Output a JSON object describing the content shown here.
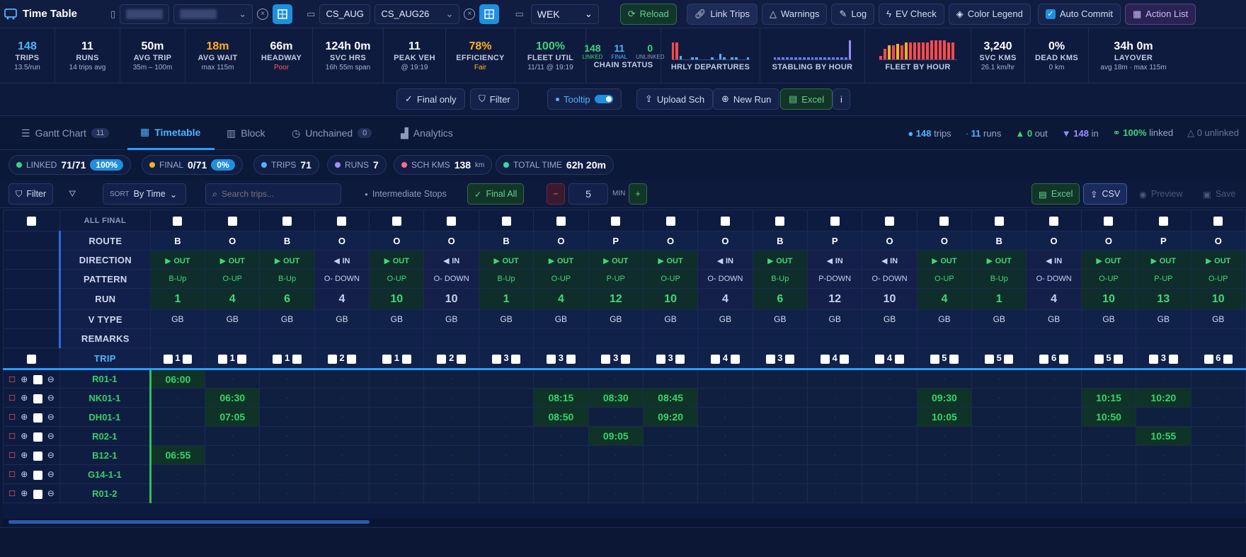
{
  "app": {
    "title": "Time Table"
  },
  "toolbar": {
    "schedule1": "CS_AUG",
    "schedule2": "CS_AUG26",
    "day": "WEK",
    "reload": "Reload",
    "link_trips": "Link Trips",
    "warnings": "Warnings",
    "log": "Log",
    "ev_check": "EV Check",
    "color_legend": "Color Legend",
    "auto_commit": "Auto Commit",
    "action_list": "Action List"
  },
  "stats": [
    {
      "v": "148",
      "l": "TRIPS",
      "s": "13.5/run",
      "color": "#4fb3ff"
    },
    {
      "v": "11",
      "l": "RUNS",
      "s": "14 trips avg",
      "color": "#ffffff"
    },
    {
      "v": "50m",
      "l": "AVG TRIP",
      "s": "35m – 100m",
      "color": "#ffffff"
    },
    {
      "v": "18m",
      "l": "AVG WAIT",
      "s": "max 115m",
      "color": "#ffb020"
    },
    {
      "v": "66m",
      "l": "HEADWAY",
      "s": "Poor",
      "color": "#ffffff",
      "scolor": "#ff5a5a"
    },
    {
      "v": "124h 0m",
      "l": "SVC HRS",
      "s": "16h 55m span",
      "color": "#ffffff"
    },
    {
      "v": "11",
      "l": "PEAK VEH",
      "s": "@ 19:19",
      "color": "#ffffff"
    },
    {
      "v": "78%",
      "l": "EFFICIENCY",
      "s": "Fair",
      "color": "#ffb020",
      "scolor": "#ffb020"
    },
    {
      "v": "100%",
      "l": "FLEET UTIL",
      "s": "11/11 @ 19:19",
      "color": "#3ed47a"
    }
  ],
  "chain": {
    "linked": "148",
    "linked_l": "LINKED",
    "final": "11",
    "final_l": "FINAL",
    "unlinked": "0",
    "unlinked_l": "UNLINKED",
    "label": "CHAIN STATUS"
  },
  "charts": {
    "hourly": "HRLY DEPARTURES",
    "stabling": "STABLING BY HOUR",
    "fleet": "FLEET BY HOUR"
  },
  "stats2": [
    {
      "v": "3,240",
      "l": "SVC KMS",
      "s": "26.1 km/hr"
    },
    {
      "v": "0%",
      "l": "DEAD KMS",
      "s": "0 km"
    },
    {
      "v": "34h 0m",
      "l": "LAYOVER",
      "s": "avg 18m · max 115m"
    }
  ],
  "actions": {
    "final_only": "Final only",
    "filter": "Filter",
    "tooltip": "Tooltip",
    "upload": "Upload Sch",
    "new_run": "New Run",
    "excel": "Excel",
    "info": "i"
  },
  "tabs": {
    "gantt": "Gantt Chart",
    "gantt_count": "11",
    "timetable": "Timetable",
    "block": "Block",
    "unchained": "Unchained",
    "unchained_count": "0",
    "analytics": "Analytics"
  },
  "tabstats": {
    "trips": "148",
    "trips_l": "trips",
    "runs": "11",
    "runs_l": "runs",
    "out": "0",
    "out_l": "out",
    "in": "148",
    "in_l": "in",
    "linked": "100%",
    "linked_l": "linked",
    "unlinked": "0 unlinked"
  },
  "chips": {
    "linked_l": "LINKED",
    "linked": "71/71",
    "linked_pct": "100%",
    "final_l": "FINAL",
    "final": "0/71",
    "final_pct": "0%",
    "trips_l": "TRIPS",
    "trips": "71",
    "runs_l": "RUNS",
    "runs": "7",
    "kms_l": "SCH KMS",
    "kms": "138",
    "kms_u": "km",
    "time_l": "TOTAL TIME",
    "time": "62h 20m"
  },
  "filterbar": {
    "filter": "Filter",
    "sort_l": "SORT",
    "sort": "By Time",
    "search_ph": "Search trips...",
    "intermediate": "Intermediate Stops",
    "final_all": "Final All",
    "minus": "−",
    "mins": "5",
    "min_l": "MIN",
    "plus": "+",
    "excel": "Excel",
    "csv": "CSV",
    "preview": "Preview",
    "save": "Save"
  },
  "grid": {
    "labels": {
      "all_final": "ALL FINAL",
      "route": "ROUTE",
      "direction": "DIRECTION",
      "pattern": "PATTERN",
      "run": "RUN",
      "vtype": "V TYPE",
      "remarks": "REMARKS",
      "trip": "TRIP"
    },
    "columns": [
      {
        "route": "B",
        "dir": "OUT",
        "pattern": "B-Up",
        "run": "1",
        "vtype": "GB",
        "trip": "1"
      },
      {
        "route": "O",
        "dir": "OUT",
        "pattern": "O-UP",
        "run": "4",
        "vtype": "GB",
        "trip": "1"
      },
      {
        "route": "B",
        "dir": "OUT",
        "pattern": "B-Up",
        "run": "6",
        "vtype": "GB",
        "trip": "1"
      },
      {
        "route": "O",
        "dir": "IN",
        "pattern": "O- DOWN",
        "run": "4",
        "vtype": "GB",
        "trip": "2"
      },
      {
        "route": "O",
        "dir": "OUT",
        "pattern": "O-UP",
        "run": "10",
        "vtype": "GB",
        "trip": "1"
      },
      {
        "route": "O",
        "dir": "IN",
        "pattern": "O- DOWN",
        "run": "10",
        "vtype": "GB",
        "trip": "2"
      },
      {
        "route": "B",
        "dir": "OUT",
        "pattern": "B-Up",
        "run": "1",
        "vtype": "GB",
        "trip": "3"
      },
      {
        "route": "O",
        "dir": "OUT",
        "pattern": "O-UP",
        "run": "4",
        "vtype": "GB",
        "trip": "3"
      },
      {
        "route": "P",
        "dir": "OUT",
        "pattern": "P-UP",
        "run": "12",
        "vtype": "GB",
        "trip": "3"
      },
      {
        "route": "O",
        "dir": "OUT",
        "pattern": "O-UP",
        "run": "10",
        "vtype": "GB",
        "trip": "3"
      },
      {
        "route": "O",
        "dir": "IN",
        "pattern": "O- DOWN",
        "run": "4",
        "vtype": "GB",
        "trip": "4"
      },
      {
        "route": "B",
        "dir": "OUT",
        "pattern": "B-Up",
        "run": "6",
        "vtype": "GB",
        "trip": "3"
      },
      {
        "route": "P",
        "dir": "IN",
        "pattern": "P-DOWN",
        "run": "12",
        "vtype": "GB",
        "trip": "4"
      },
      {
        "route": "O",
        "dir": "IN",
        "pattern": "O- DOWN",
        "run": "10",
        "vtype": "GB",
        "trip": "4"
      },
      {
        "route": "O",
        "dir": "OUT",
        "pattern": "O-UP",
        "run": "4",
        "vtype": "GB",
        "trip": "5"
      },
      {
        "route": "B",
        "dir": "OUT",
        "pattern": "B-Up",
        "run": "1",
        "vtype": "GB",
        "trip": "5"
      },
      {
        "route": "O",
        "dir": "IN",
        "pattern": "O- DOWN",
        "run": "4",
        "vtype": "GB",
        "trip": "6"
      },
      {
        "route": "O",
        "dir": "OUT",
        "pattern": "O-UP",
        "run": "10",
        "vtype": "GB",
        "trip": "5"
      },
      {
        "route": "P",
        "dir": "OUT",
        "pattern": "P-UP",
        "run": "13",
        "vtype": "GB",
        "trip": "3"
      },
      {
        "route": "O",
        "dir": "OUT",
        "pattern": "O-UP",
        "run": "10",
        "vtype": "GB",
        "trip": "6"
      }
    ],
    "stops": [
      {
        "name": "R01-1",
        "times": {
          "0": "06:00"
        }
      },
      {
        "name": "NK01-1",
        "times": {
          "1": "06:30",
          "7": "08:15",
          "8": "08:30",
          "9": "08:45",
          "14": "09:30",
          "17": "10:15",
          "18": "10:20"
        }
      },
      {
        "name": "DH01-1",
        "times": {
          "1": "07:05",
          "7": "08:50",
          "9": "09:20",
          "14": "10:05",
          "17": "10:50"
        }
      },
      {
        "name": "R02-1",
        "times": {
          "8": "09:05",
          "18": "10:55"
        }
      },
      {
        "name": "B12-1",
        "times": {
          "0": "06:55"
        }
      },
      {
        "name": "G14-1-1",
        "times": {}
      },
      {
        "name": "R01-2",
        "times": {}
      }
    ]
  },
  "colors": {
    "accent": "#1f8fe0",
    "green": "#36d46e",
    "amber": "#ffb020",
    "red": "#ff5a5a"
  }
}
